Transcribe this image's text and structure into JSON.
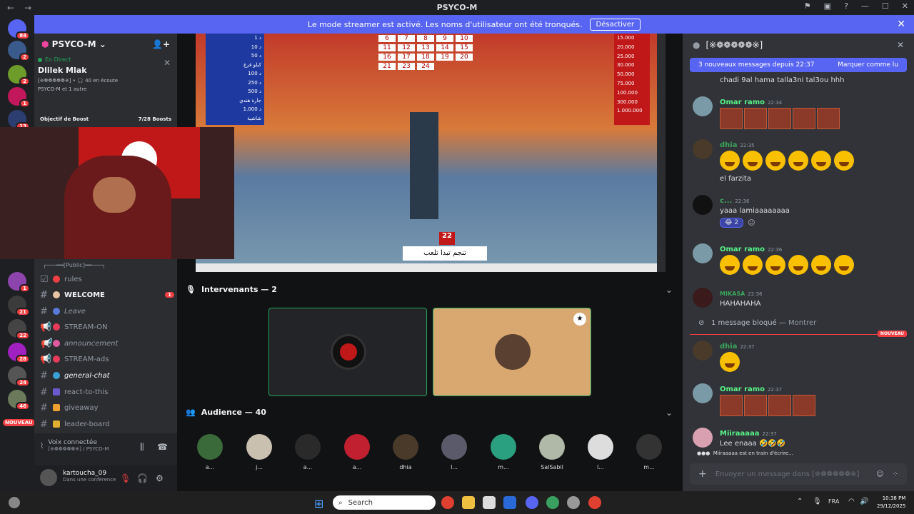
{
  "titlebar": {
    "title": "PSYCO-M",
    "back": "←",
    "forward": "→"
  },
  "banner": {
    "text": "Le mode streamer est activé. Les noms d'utilisateur ont été tronqués.",
    "button": "Désactiver"
  },
  "servers": {
    "badges": [
      "84",
      "2",
      "2",
      "1",
      "13",
      "1",
      "21",
      "22",
      "28",
      "24",
      "46"
    ],
    "new_label": "NOUVEAU"
  },
  "channels": {
    "server_name": "PSYCO-M",
    "live": {
      "status": "En Direct",
      "name": "Dlilek Mlak",
      "listening": "40 en écoute",
      "members": "PSYCO-M et 1 autre",
      "server_tag": "[※❁❁❁❁❁※]"
    },
    "boost": {
      "label": "Objectif de Boost",
      "count": "7/28 Boosts"
    },
    "category": "┌───━━[Public]━━───┐",
    "items": [
      {
        "name": "rules"
      },
      {
        "name": "WELCOME",
        "badge": "1"
      },
      {
        "name": "Leave"
      },
      {
        "name": "STREAM-ON"
      },
      {
        "name": "announcement"
      },
      {
        "name": "STREAM-ads"
      },
      {
        "name": "general-chat"
      },
      {
        "name": "react-to-this"
      },
      {
        "name": "giveaway"
      },
      {
        "name": "leader-board"
      }
    ],
    "voice": {
      "status": "Voix connectée",
      "where": "[※❁❁❁❁❁※] / PSYCO-M"
    },
    "user": {
      "name": "kartoucha_09",
      "status": "Dans une conférence"
    }
  },
  "stage": {
    "speakers_label": "Intervenants — 2",
    "audience_label": "Audience — 40",
    "video_caption": "تنجم تبدا تلعب",
    "box_number": "22",
    "grid_numbers": [
      "6",
      "7",
      "8",
      "9",
      "10",
      "11",
      "12",
      "13",
      "14",
      "15",
      "16",
      "17",
      "18",
      "19",
      "20",
      "21",
      "23",
      "24"
    ],
    "prizes_right": [
      "15.000",
      "20.000",
      "25.000",
      "30.000",
      "50.000",
      "75.000",
      "100.000",
      "300.000",
      "1.000.000"
    ],
    "prizes_left": [
      "1 د",
      "10 د",
      "50 د",
      "كيلو قرع",
      "100 د",
      "250 د",
      "500 د",
      "جارة هندي",
      "1.000 د",
      "شاشية"
    ],
    "audience": [
      "a...",
      "j...",
      "a...",
      "a...",
      "dhia",
      "l...",
      "m...",
      "SalSabil",
      "l...",
      "m..."
    ]
  },
  "chat": {
    "channel": "[※❁❁❁❁❁※]",
    "new_messages": "3 nouveaux messages depuis 22:37",
    "mark_read": "Marquer comme lu",
    "first_text": "chadi 9al hama talla3ni tal3ou hhh",
    "messages": [
      {
        "author": "Omar ramo",
        "time": "22:34"
      },
      {
        "author": "dhia",
        "time": "22:35",
        "text": "el farzita"
      },
      {
        "author": "c...",
        "time": "22:36",
        "text": "yaaa lamiaaaaaaaa",
        "reaction": "2"
      },
      {
        "author": "Omar ramo",
        "time": "22:36"
      },
      {
        "author": "MIKASA",
        "time": "22:36",
        "text": "HAHAHAHA"
      },
      {
        "author": "dhia",
        "time": "22:37"
      },
      {
        "author": "Omar ramo",
        "time": "22:37"
      },
      {
        "author": "Miiraaaaa",
        "time": "22:37",
        "text": "Lee enaaa"
      }
    ],
    "blocked": "1 message bloqué — ",
    "blocked_show": "Montrer",
    "nouveau": "NOUVEAU",
    "typing": "Miiraaaaa est en train d'écrire...",
    "placeholder": "Envoyer un message dans [※❁❁❁❁❁※]"
  },
  "taskbar": {
    "search": "Search",
    "lang": "FRA",
    "time": "10:38 PM",
    "date": "29/12/2025"
  }
}
